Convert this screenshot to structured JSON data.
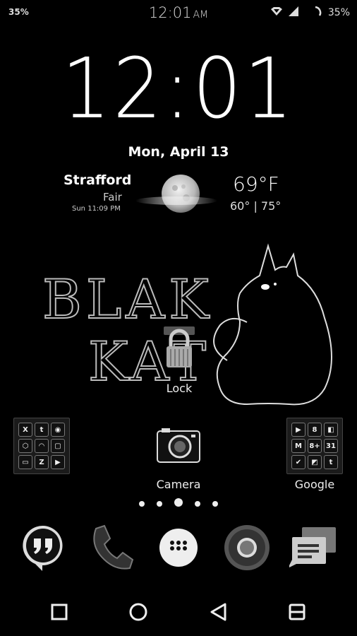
{
  "status_bar": {
    "battery_left": "35%",
    "time": "12:01",
    "ampm": "AM",
    "battery_right": "35%"
  },
  "clock": {
    "time": "12:01"
  },
  "date": "Mon, April 13",
  "weather": {
    "city": "Strafford",
    "condition": "Fair",
    "updated": "Sun 11:09 PM",
    "temp": "69°F",
    "range": "60° | 75°"
  },
  "logo": {
    "text_line1": "BLAK",
    "text_line2": "KAT"
  },
  "lock": {
    "label": "Lock"
  },
  "home": {
    "camera_label": "Camera",
    "google_label": "Google",
    "left_folder": [
      "X",
      "t",
      "◉",
      "⬡",
      "◠",
      "▢",
      "▭",
      "Z",
      "▶"
    ],
    "right_folder": [
      "▶",
      "8",
      "◧",
      "M",
      "8+",
      "31",
      "✔",
      "◩",
      "t"
    ]
  },
  "page_indicator": {
    "count": 5,
    "current": 3
  }
}
